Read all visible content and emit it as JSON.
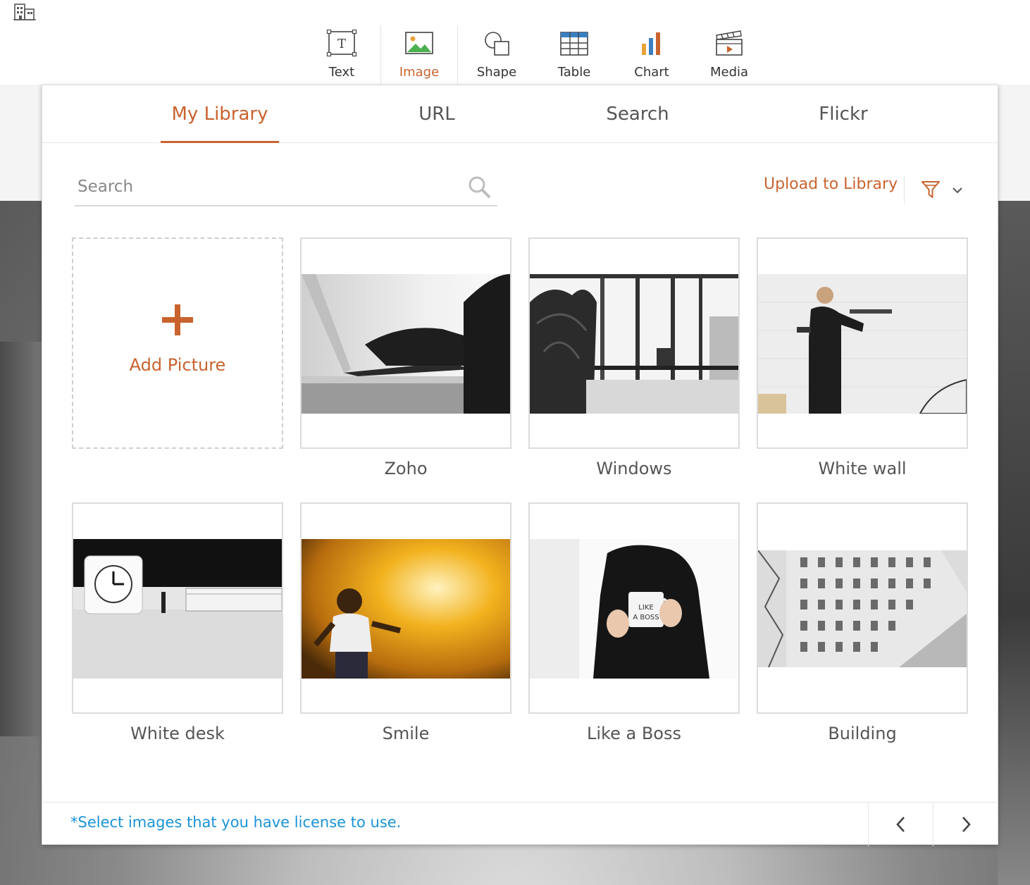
{
  "toolbar": {
    "items": [
      {
        "label": "Text",
        "icon": "text-box-icon"
      },
      {
        "label": "Image",
        "icon": "image-icon",
        "active": true
      },
      {
        "label": "Shape",
        "icon": "shape-icon"
      },
      {
        "label": "Table",
        "icon": "table-icon"
      },
      {
        "label": "Chart",
        "icon": "bar-chart-icon"
      },
      {
        "label": "Media",
        "icon": "clapperboard-icon"
      }
    ]
  },
  "dialog": {
    "tabs": [
      {
        "label": "My Library",
        "active": true
      },
      {
        "label": "URL"
      },
      {
        "label": "Search"
      },
      {
        "label": "Flickr"
      }
    ],
    "search": {
      "placeholder": "Search",
      "value": ""
    },
    "upload_label": "Upload to Library",
    "add_picture_label": "Add Picture",
    "images": [
      {
        "caption": "Zoho"
      },
      {
        "caption": "Windows"
      },
      {
        "caption": "White wall"
      },
      {
        "caption": "White desk"
      },
      {
        "caption": "Smile"
      },
      {
        "caption": "Like a Boss"
      },
      {
        "caption": "Building"
      }
    ],
    "footer_note": "*Select images that you have license to use."
  },
  "colors": {
    "accent": "#c9632e",
    "link_blue": "#1a93d6",
    "border": "#dcdcdc"
  }
}
